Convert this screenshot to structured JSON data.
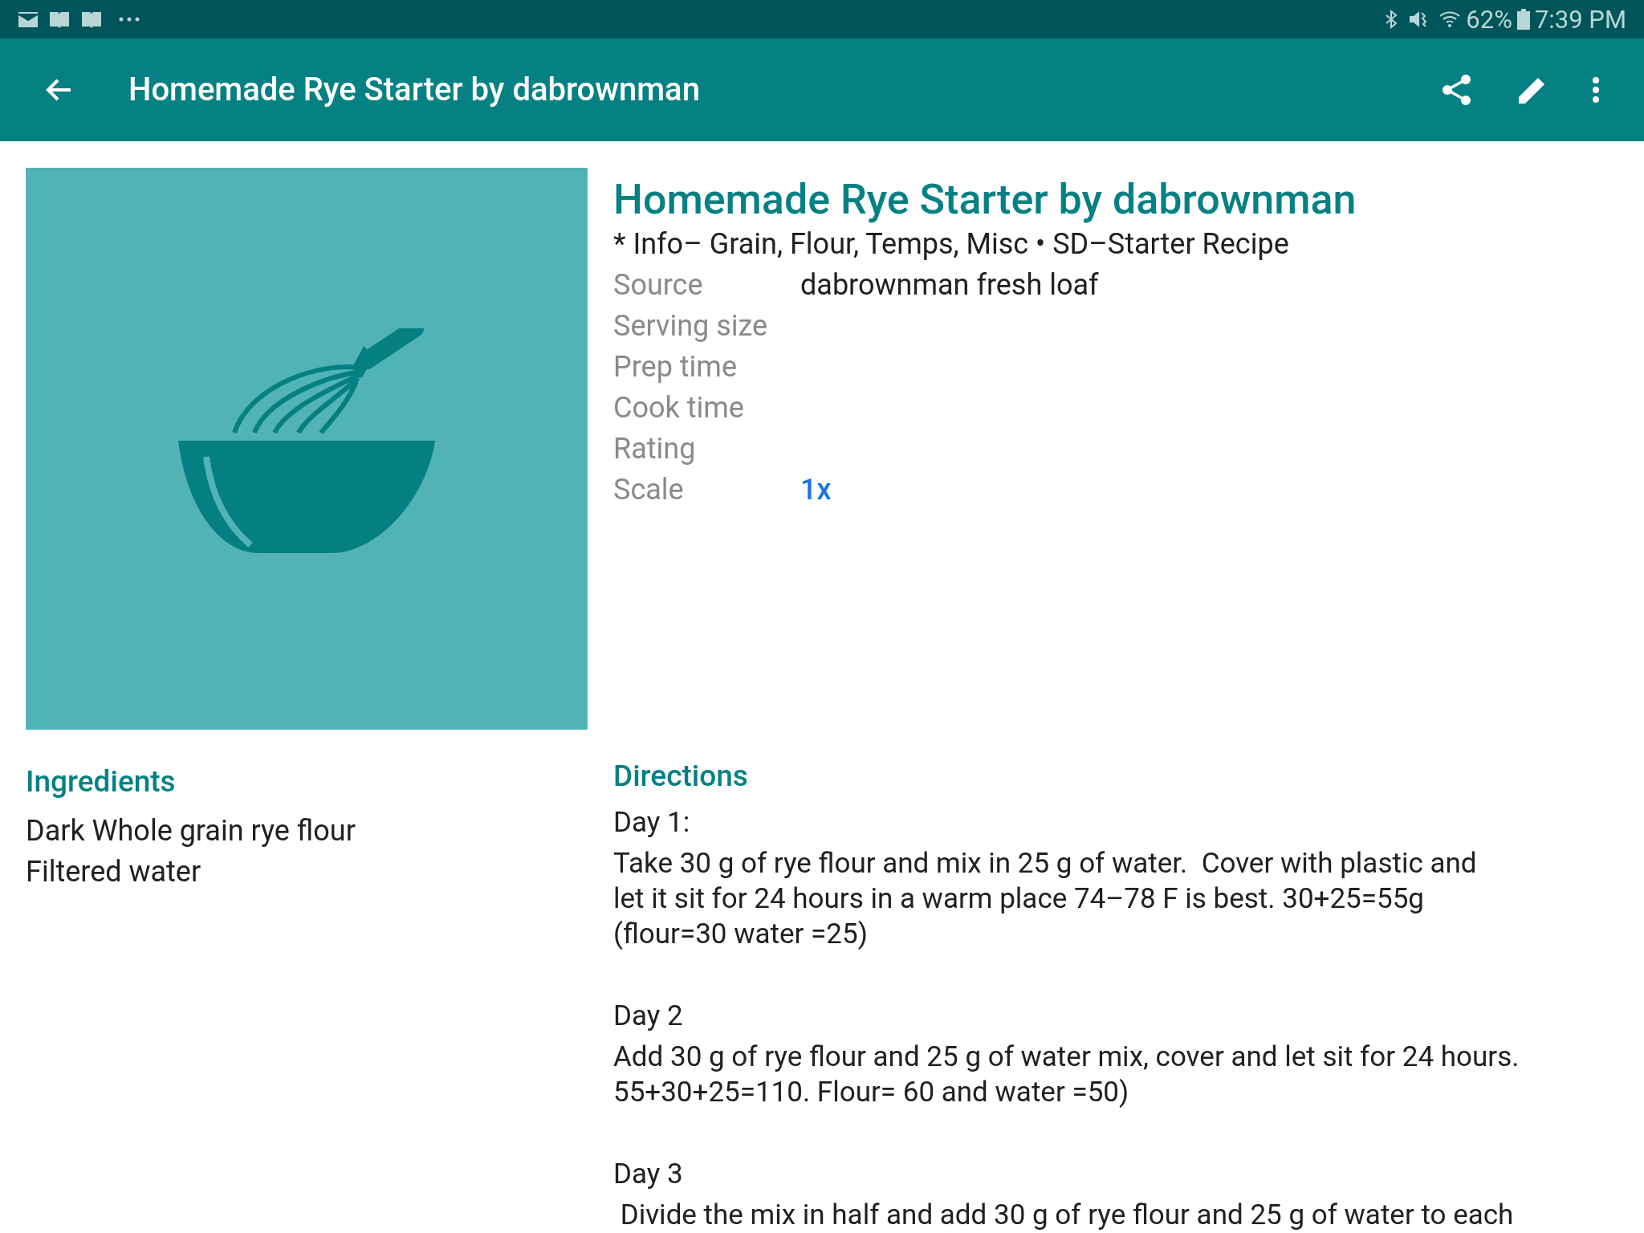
{
  "status_bar": {
    "battery": "62%",
    "time": "7:39 PM"
  },
  "app_bar": {
    "title": "Homemade Rye Starter by dabrownman"
  },
  "recipe": {
    "title": "Homemade Rye Starter by dabrownman",
    "categories": "* Info– Grain, Flour, Temps, Misc • SD–Starter Recipe",
    "details": [
      {
        "label": "Source",
        "value": "dabrownman fresh loaf",
        "kind": "text"
      },
      {
        "label": "Serving size"
      },
      {
        "label": "Prep time"
      },
      {
        "label": "Cook time"
      },
      {
        "label": "Rating"
      },
      {
        "label": "Scale",
        "value": "1x",
        "kind": "link"
      }
    ]
  },
  "ingredients": {
    "heading": "Ingredients",
    "items": [
      "Dark Whole grain rye flour",
      "Filtered water"
    ]
  },
  "directions": {
    "heading": "Directions",
    "steps": [
      {
        "lines": [
          "Day 1:",
          "Take 30 g of rye flour and mix in 25 g of water.  Cover with plastic and",
          "let it sit for 24 hours in a warm place 74–78 F is best. 30+25=55g",
          "(flour=30 water =25)"
        ]
      },
      {
        "lines": [
          "Day 2",
          "Add 30 g of rye flour and 25 g of water mix, cover and let sit for 24 hours.",
          "55+30+25=110. Flour= 60 and water =50)"
        ]
      },
      {
        "lines": [
          "Day 3",
          " Divide the mix in half and add 30 g of rye flour and 25 g of water to each"
        ]
      }
    ]
  }
}
